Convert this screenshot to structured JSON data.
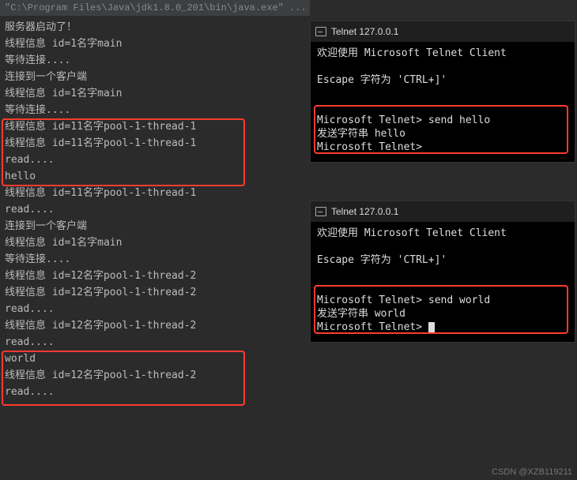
{
  "left": {
    "header": "\"C:\\Program Files\\Java\\jdk1.8.0_201\\bin\\java.exe\" ...",
    "lines": [
      "服务器启动了！",
      "线程信息 id=1名字main",
      "等待连接....",
      "连接到一个客户端",
      "线程信息 id=1名字main",
      "等待连接....",
      "线程信息 id=11名字pool-1-thread-1",
      "线程信息 id=11名字pool-1-thread-1",
      "read....",
      "hello",
      "线程信息 id=11名字pool-1-thread-1",
      "read....",
      "连接到一个客户端",
      "线程信息 id=1名字main",
      "等待连接....",
      "线程信息 id=12名字pool-1-thread-2",
      "线程信息 id=12名字pool-1-thread-2",
      "read....",
      "",
      "",
      "线程信息 id=12名字pool-1-thread-2",
      "read....",
      "world",
      "线程信息 id=12名字pool-1-thread-2",
      "read...."
    ]
  },
  "telnet1": {
    "title": "Telnet 127.0.0.1",
    "welcome": "欢迎使用 Microsoft Telnet Client",
    "escape": "Escape 字符为 'CTRL+]'",
    "prompt1": "Microsoft Telnet> send hello",
    "sendline": "发送字符串 hello",
    "prompt2": "Microsoft Telnet>"
  },
  "telnet2": {
    "title": "Telnet 127.0.0.1",
    "welcome": "欢迎使用 Microsoft Telnet Client",
    "escape": "Escape 字符为 'CTRL+]'",
    "prompt1": "Microsoft Telnet> send world",
    "sendline": "发送字符串 world",
    "prompt2": "Microsoft Telnet> "
  },
  "watermark": "CSDN @XZB119211"
}
